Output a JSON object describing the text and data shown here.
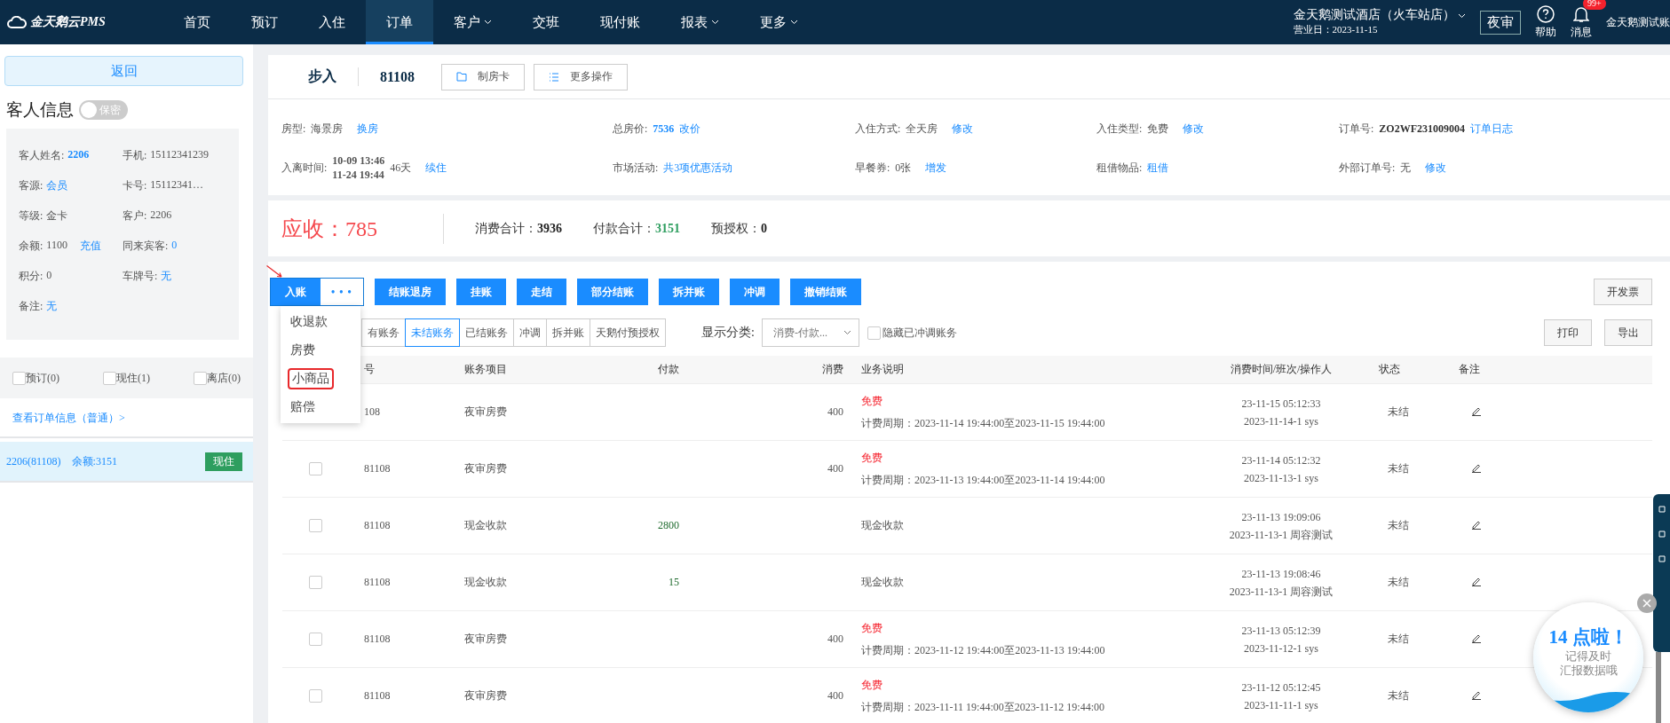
{
  "nav": {
    "logo": "金天鹅云PMS",
    "items": [
      {
        "label": "首页",
        "selected": false,
        "has_menu": false
      },
      {
        "label": "预订",
        "selected": false,
        "has_menu": false
      },
      {
        "label": "入住",
        "selected": false,
        "has_menu": false
      },
      {
        "label": "订单",
        "selected": true,
        "has_menu": false
      },
      {
        "label": "客户",
        "selected": false,
        "has_menu": true
      },
      {
        "label": "交班",
        "selected": false,
        "has_menu": false
      },
      {
        "label": "现付账",
        "selected": false,
        "has_menu": false
      },
      {
        "label": "报表",
        "selected": false,
        "has_menu": true
      },
      {
        "label": "更多",
        "selected": false,
        "has_menu": true
      }
    ],
    "hotel": "金天鹅测试酒店（火车站店）",
    "business_date": "营业日：2023-11-15",
    "night_audit": "夜审",
    "help": "帮助",
    "messages": "消息",
    "badge": "99+",
    "user": "金天鹅测试账"
  },
  "sidebar": {
    "back": "返回",
    "title": "客人信息",
    "privacy": {
      "label": "保密",
      "on": false
    },
    "fields": [
      {
        "label": "客人姓名:",
        "parts": [
          {
            "text": "2206",
            "kind": "bold-link"
          }
        ]
      },
      {
        "label": "手机:",
        "parts": [
          {
            "text": "15112341239",
            "kind": "plain"
          }
        ]
      },
      {
        "label": "客源:",
        "parts": [
          {
            "text": "会员",
            "kind": "link"
          }
        ]
      },
      {
        "label": "卡号:",
        "parts": [
          {
            "text": "15112341…",
            "kind": "plain"
          }
        ]
      },
      {
        "label": "等级:",
        "parts": [
          {
            "text": "金卡",
            "kind": "plain"
          }
        ]
      },
      {
        "label": "客户:",
        "parts": [
          {
            "text": "2206",
            "kind": "plain"
          }
        ]
      },
      {
        "label": "余额:",
        "parts": [
          {
            "text": "1100",
            "kind": "plain"
          },
          {
            "text": "充值",
            "kind": "link"
          }
        ]
      },
      {
        "label": "同来宾客:",
        "parts": [
          {
            "text": "0",
            "kind": "link"
          }
        ]
      },
      {
        "label": "积分:",
        "parts": [
          {
            "text": "0",
            "kind": "plain"
          }
        ]
      },
      {
        "label": "车牌号:",
        "parts": [
          {
            "text": "无",
            "kind": "link"
          }
        ]
      },
      {
        "label": "备注:",
        "parts": [
          {
            "text": "无",
            "kind": "link"
          }
        ]
      }
    ],
    "filters": [
      {
        "label": "预订(0)",
        "checked": false
      },
      {
        "label": "现住(1)",
        "checked": false
      },
      {
        "label": "离店(0)",
        "checked": false
      }
    ],
    "order_link": "查看订单信息（普通）>",
    "rooms": [
      {
        "label": "2206(81108)",
        "balance": "余额:3151",
        "status": "现住",
        "selected": true
      }
    ]
  },
  "order": {
    "entry": "步入",
    "room": "81108",
    "buttons": [
      {
        "label": "制房卡"
      },
      {
        "label": "更多操作"
      }
    ],
    "info": [
      {
        "label": "房型:",
        "parts": [
          {
            "text": "海景房",
            "kind": "plain"
          },
          {
            "text": "换房",
            "kind": "link"
          }
        ]
      },
      {
        "label": "总房价:",
        "parts": [
          {
            "text": "7536",
            "kind": "bold-link"
          },
          {
            "text": "改价",
            "kind": "link"
          }
        ]
      },
      {
        "label": "入住方式:",
        "parts": [
          {
            "text": "全天房",
            "kind": "plain"
          },
          {
            "text": "修改",
            "kind": "link"
          }
        ]
      },
      {
        "label": "入住类型:",
        "parts": [
          {
            "text": "免费",
            "kind": "plain"
          },
          {
            "text": "修改",
            "kind": "link"
          }
        ]
      },
      {
        "label": "订单号:",
        "parts": [
          {
            "text": "ZO2WF231009004",
            "kind": "bold"
          },
          {
            "text": "订单日志",
            "kind": "link"
          }
        ]
      },
      {
        "label": "入离时间:",
        "parts": [
          {
            "text": "10-09 13:46",
            "kind": "stack-top"
          },
          {
            "text": "11-24 19:44",
            "kind": "stack-bottom"
          },
          {
            "text": "46天",
            "kind": "plain"
          },
          {
            "text": "续住",
            "kind": "link"
          }
        ]
      },
      {
        "label": "市场活动:",
        "parts": [
          {
            "text": "共3项优惠活动",
            "kind": "link"
          }
        ]
      },
      {
        "label": "早餐券:",
        "parts": [
          {
            "text": "0张",
            "kind": "plain"
          },
          {
            "text": "增发",
            "kind": "link"
          }
        ]
      },
      {
        "label": "租借物品:",
        "parts": [
          {
            "text": "租借",
            "kind": "link"
          }
        ]
      },
      {
        "label": "外部订单号:",
        "parts": [
          {
            "text": "无",
            "kind": "plain"
          },
          {
            "text": "修改",
            "kind": "link"
          }
        ]
      }
    ]
  },
  "summary": {
    "due_label": "应收：",
    "due": "785",
    "totals": [
      {
        "label": "消费合计：",
        "value": "3936",
        "kind": "plain"
      },
      {
        "label": "付款合计：",
        "value": "3151",
        "kind": "positive"
      },
      {
        "label": "预授权：",
        "value": "0",
        "kind": "plain"
      }
    ]
  },
  "actions": {
    "primary": "入账",
    "more": "• • •",
    "buttons": [
      "结账退房",
      "挂账",
      "走结",
      "部分结账",
      "拆并账",
      "冲调",
      "撤销结账"
    ],
    "invoice": "开发票",
    "menu": [
      {
        "label": "收退款",
        "marked": false
      },
      {
        "label": "房费",
        "marked": false
      },
      {
        "label": "小商品",
        "marked": true
      },
      {
        "label": "赔偿",
        "marked": false
      }
    ]
  },
  "filters": {
    "tabs": [
      {
        "label": "有账务",
        "selected": false
      },
      {
        "label": "未结账务",
        "selected": true
      },
      {
        "label": "已结账务",
        "selected": false
      },
      {
        "label": "冲调",
        "selected": false
      },
      {
        "label": "拆并账",
        "selected": false
      },
      {
        "label": "天鹅付预授权",
        "selected": false
      }
    ],
    "category_label": "显示分类:",
    "category": "消费-付款...",
    "hide_reversed": {
      "label": "隐藏已冲调账务",
      "checked": false
    },
    "buttons": [
      "打印",
      "导出"
    ]
  },
  "table": {
    "columns": [
      "号",
      "账务项目",
      "付款",
      "消费",
      "业务说明",
      "消费时间/班次/操作人",
      "状态",
      "备注"
    ],
    "rows": [
      {
        "room": "108",
        "item": "夜审房费",
        "cost": "400",
        "tag": "免费",
        "desc": "计费周期：2023-11-14 19:44:00至2023-11-15 19:44:00",
        "time": "23-11-15 05:12:33",
        "shift": "2023-11-14-1 sys",
        "status": "未结"
      },
      {
        "checked": false,
        "room": "81108",
        "item": "夜审房费",
        "cost": "400",
        "tag": "免费",
        "desc": "计费周期：2023-11-13 19:44:00至2023-11-14 19:44:00",
        "time": "23-11-14 05:12:32",
        "shift": "2023-11-13-1 sys",
        "status": "未结"
      },
      {
        "checked": false,
        "room": "81108",
        "item": "现金收款",
        "payment": "2800",
        "desc": "现金收款",
        "time": "23-11-13 19:09:06",
        "shift": "2023-11-13-1 周容测试",
        "status": "未结"
      },
      {
        "checked": false,
        "room": "81108",
        "item": "现金收款",
        "payment": "15",
        "desc": "现金收款",
        "time": "23-11-13 19:08:46",
        "shift": "2023-11-13-1 周容测试",
        "status": "未结"
      },
      {
        "checked": false,
        "room": "81108",
        "item": "夜审房费",
        "cost": "400",
        "tag": "免费",
        "desc": "计费周期：2023-11-12 19:44:00至2023-11-13 19:44:00",
        "time": "23-11-13 05:12:39",
        "shift": "2023-11-12-1 sys",
        "status": "未结"
      },
      {
        "checked": false,
        "room": "81108",
        "item": "夜审房费",
        "cost": "400",
        "tag": "免费",
        "desc": "计费周期：2023-11-11 19:44:00至2023-11-12 19:44:00",
        "time": "23-11-12 05:12:45",
        "shift": "2023-11-11-1 sys",
        "status": "未结"
      }
    ]
  },
  "reminder": {
    "title": "14 点啦！",
    "lines": [
      "记得及时",
      "汇报数据哦"
    ]
  }
}
